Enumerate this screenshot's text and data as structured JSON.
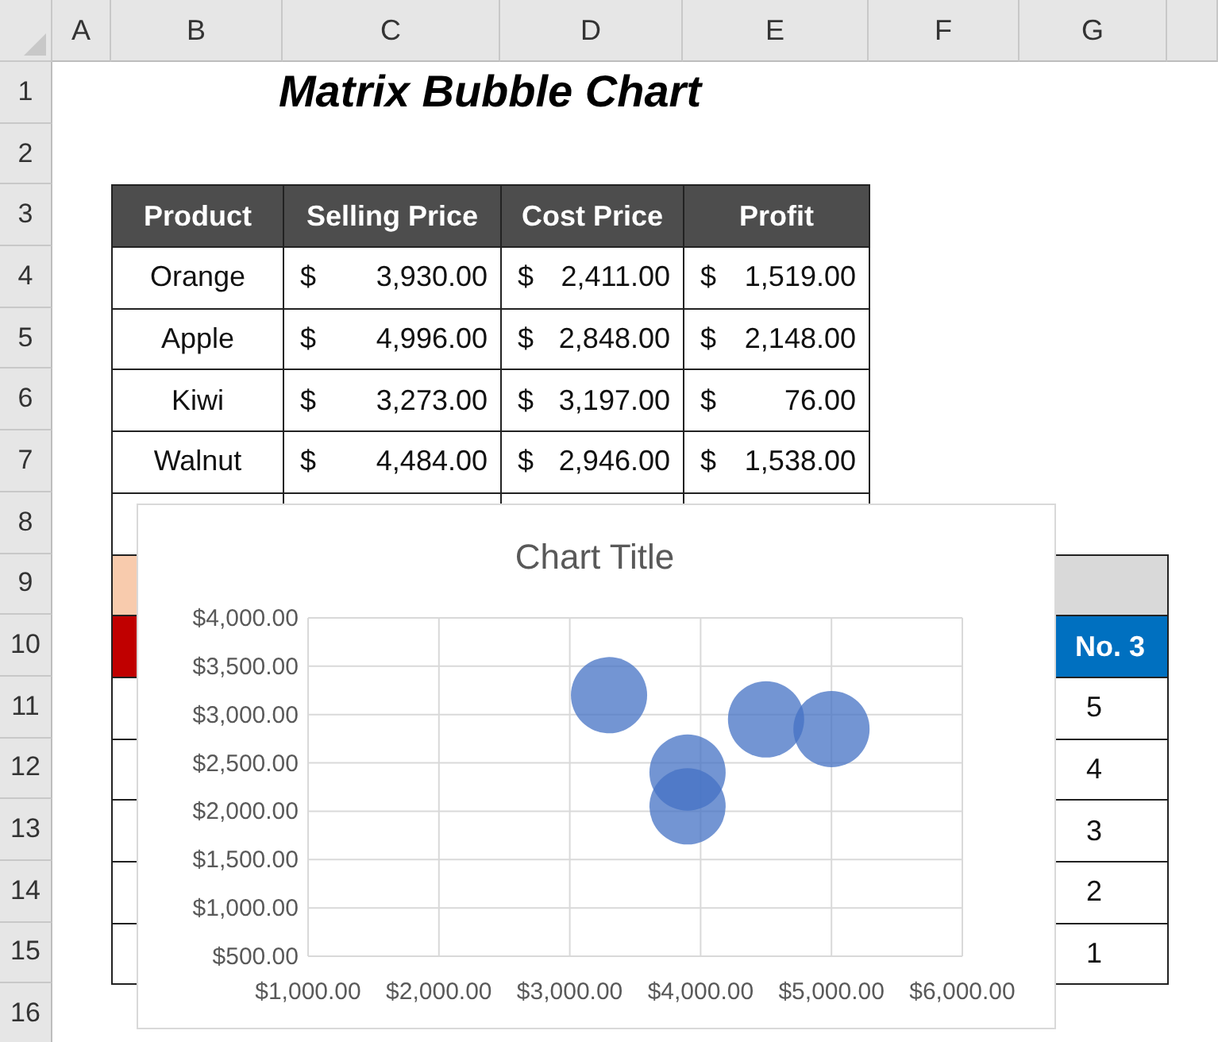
{
  "columns": [
    "A",
    "B",
    "C",
    "D",
    "E",
    "F",
    "G"
  ],
  "rows": [
    "1",
    "2",
    "3",
    "4",
    "5",
    "6",
    "7",
    "8",
    "9",
    "10",
    "11",
    "12",
    "13",
    "14",
    "15",
    "16"
  ],
  "title": "Matrix Bubble Chart",
  "table": {
    "columns": [
      "Product",
      "Selling Price",
      "Cost Price",
      "Profit"
    ],
    "rows": [
      {
        "cells": [
          {
            "kind": "text",
            "text": "Orange"
          },
          {
            "kind": "money",
            "sign": "$",
            "amount": "3,930.00"
          },
          {
            "kind": "money",
            "sign": "$",
            "amount": "2,411.00"
          },
          {
            "kind": "money",
            "sign": "$",
            "amount": "1,519.00"
          }
        ]
      },
      {
        "cells": [
          {
            "kind": "text",
            "text": "Apple"
          },
          {
            "kind": "money",
            "sign": "$",
            "amount": "4,996.00"
          },
          {
            "kind": "money",
            "sign": "$",
            "amount": "2,848.00"
          },
          {
            "kind": "money",
            "sign": "$",
            "amount": "2,148.00"
          }
        ]
      },
      {
        "cells": [
          {
            "kind": "text",
            "text": "Kiwi"
          },
          {
            "kind": "money",
            "sign": "$",
            "amount": "3,273.00"
          },
          {
            "kind": "money",
            "sign": "$",
            "amount": "3,197.00"
          },
          {
            "kind": "money",
            "sign": "$",
            "amount": "76.00"
          }
        ]
      },
      {
        "cells": [
          {
            "kind": "text",
            "text": "Walnut"
          },
          {
            "kind": "money",
            "sign": "$",
            "amount": "4,484.00"
          },
          {
            "kind": "money",
            "sign": "$",
            "amount": "2,946.00"
          },
          {
            "kind": "money",
            "sign": "$",
            "amount": "1,538.00"
          }
        ]
      }
    ]
  },
  "lower_table": {
    "column_header": "No. 3",
    "values": [
      "5",
      "4",
      "3",
      "2",
      "1"
    ]
  },
  "chart": {
    "chart_data": {
      "type": "scatter",
      "title": "Chart Title",
      "grid": true,
      "x": [
        3900,
        5000,
        3300,
        4500,
        3900
      ],
      "series": [
        {
          "color": "#4472c4",
          "values": [
            2400,
            2850,
            3200,
            2950,
            2050
          ]
        }
      ],
      "xlim": [
        1000,
        6000
      ],
      "ylim": [
        500,
        4000
      ],
      "xticks": [
        {
          "value": 1000,
          "label": "$1,000.00"
        },
        {
          "value": 2000,
          "label": "$2,000.00"
        },
        {
          "value": 3000,
          "label": "$3,000.00"
        },
        {
          "value": 4000,
          "label": "$4,000.00"
        },
        {
          "value": 5000,
          "label": "$5,000.00"
        },
        {
          "value": 6000,
          "label": "$6,000.00"
        }
      ],
      "yticks": [
        {
          "value": 500,
          "label": "$500.00"
        },
        {
          "value": 1000,
          "label": "$1,000.00"
        },
        {
          "value": 1500,
          "label": "$1,500.00"
        },
        {
          "value": 2000,
          "label": "$2,000.00"
        },
        {
          "value": 2500,
          "label": "$2,500.00"
        },
        {
          "value": 3000,
          "label": "$3,000.00"
        },
        {
          "value": 3500,
          "label": "$3,500.00"
        },
        {
          "value": 4000,
          "label": "$4,000.00"
        }
      ]
    }
  }
}
